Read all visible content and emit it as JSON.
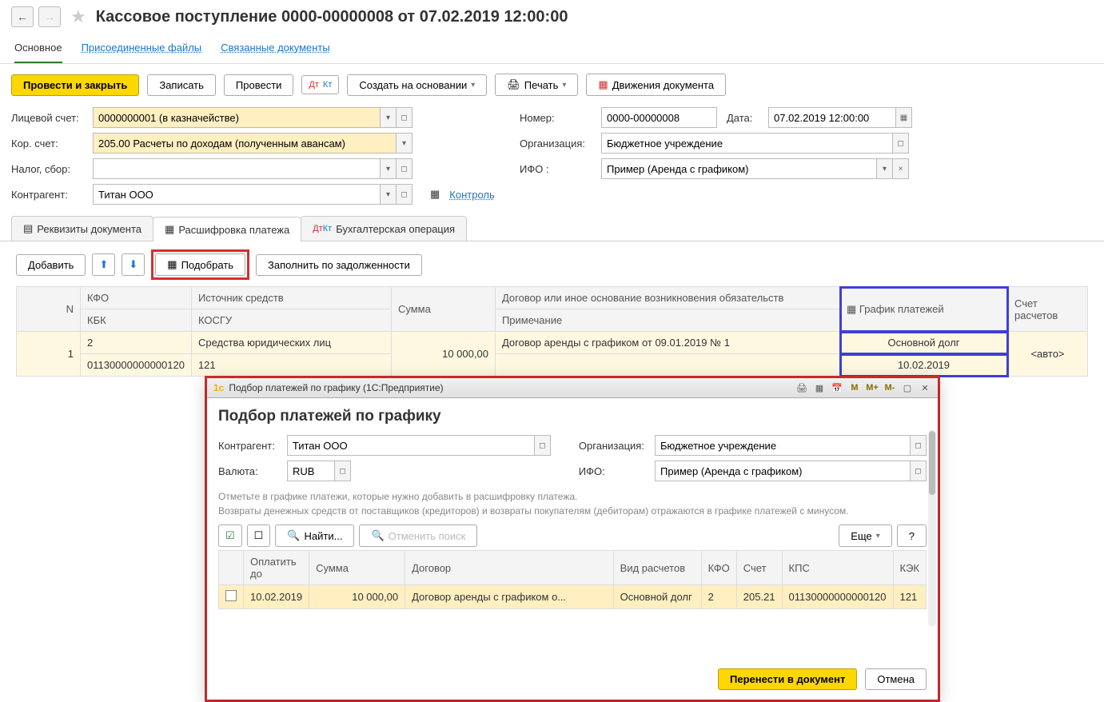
{
  "header": {
    "title": "Кассовое поступление 0000-00000008 от 07.02.2019 12:00:00"
  },
  "link_tabs": {
    "main": "Основное",
    "files": "Присоединенные файлы",
    "related": "Связанные документы"
  },
  "toolbar": {
    "post_close": "Провести и закрыть",
    "save": "Записать",
    "post": "Провести",
    "create_based": "Создать на основании",
    "print": "Печать",
    "movements": "Движения документа"
  },
  "form": {
    "account_label": "Лицевой счет:",
    "account_value": "0000000001 (в казначействе)",
    "number_label": "Номер:",
    "number_value": "0000-00000008",
    "date_label": "Дата:",
    "date_value": "07.02.2019 12:00:00",
    "corr_label": "Кор. счет:",
    "corr_value": "205.00 Расчеты по доходам (полученным авансам)",
    "org_label": "Организация:",
    "org_value": "Бюджетное учреждение",
    "tax_label": "Налог, сбор:",
    "tax_value": "",
    "ifo_label": "ИФО :",
    "ifo_value": "Пример (Аренда с графиком)",
    "contragent_label": "Контрагент:",
    "contragent_value": "Титан ООО",
    "control_link": "Контроль"
  },
  "inner_tabs": {
    "req": "Реквизиты документа",
    "decode": "Расшифровка платежа",
    "acc_op": "Бухгалтерская операция"
  },
  "sub_toolbar": {
    "add": "Добавить",
    "pick": "Подобрать",
    "fill_debt": "Заполнить по задолженности"
  },
  "table": {
    "headers": {
      "n": "N",
      "kfo": "КФО",
      "src": "Источник средств",
      "sum": "Сумма",
      "contract": "Договор или иное основание возникновения обязательств",
      "schedule": "График платежей",
      "acc": "Счет расчетов",
      "kbk": "КБК",
      "kosgu": "КОСГУ",
      "note": "Примечание"
    },
    "rows": [
      {
        "n": "1",
        "kfo": "2",
        "src": "Средства юридических лиц",
        "sum": "10 000,00",
        "contract": "Договор аренды с графиком от 09.01.2019 № 1",
        "schedule1": "Основной долг",
        "acc": "<авто>",
        "kbk": "01130000000000120",
        "kosgu": "121",
        "schedule2": "10.02.2019"
      }
    ]
  },
  "modal": {
    "window_title": "Подбор платежей по графику  (1С:Предприятие)",
    "title": "Подбор платежей по графику",
    "contragent_label": "Контрагент:",
    "contragent_value": "Титан ООО",
    "org_label": "Организация:",
    "org_value": "Бюджетное учреждение",
    "currency_label": "Валюта:",
    "currency_value": "RUB",
    "ifo_label": "ИФО:",
    "ifo_value": "Пример (Аренда с графиком)",
    "hint1": "Отметьте в графике платежи, которые нужно добавить в расшифровку платежа.",
    "hint2": "Возвраты денежных средств от поставщиков (кредиторов) и возвраты покупателям (дебиторам) отражаются в графике платежей с минусом.",
    "find": "Найти...",
    "cancel_find": "Отменить поиск",
    "more": "Еще",
    "help": "?",
    "cols": {
      "pay_before": "Оплатить до",
      "sum": "Сумма",
      "contract": "Договор",
      "settlement_type": "Вид расчетов",
      "kfo": "КФО",
      "acc": "Счет",
      "kps": "КПС",
      "kek": "КЭК"
    },
    "row": {
      "pay_before": "10.02.2019",
      "sum": "10 000,00",
      "contract": "Договор аренды с графиком о...",
      "settlement_type": "Основной долг",
      "kfo": "2",
      "acc": "205.21",
      "kps": "01130000000000120",
      "kek": "121"
    },
    "footer": {
      "transfer": "Перенести в документ",
      "cancel": "Отмена"
    },
    "m_btns": {
      "m": "M",
      "mp": "M+",
      "mm": "M-"
    }
  }
}
